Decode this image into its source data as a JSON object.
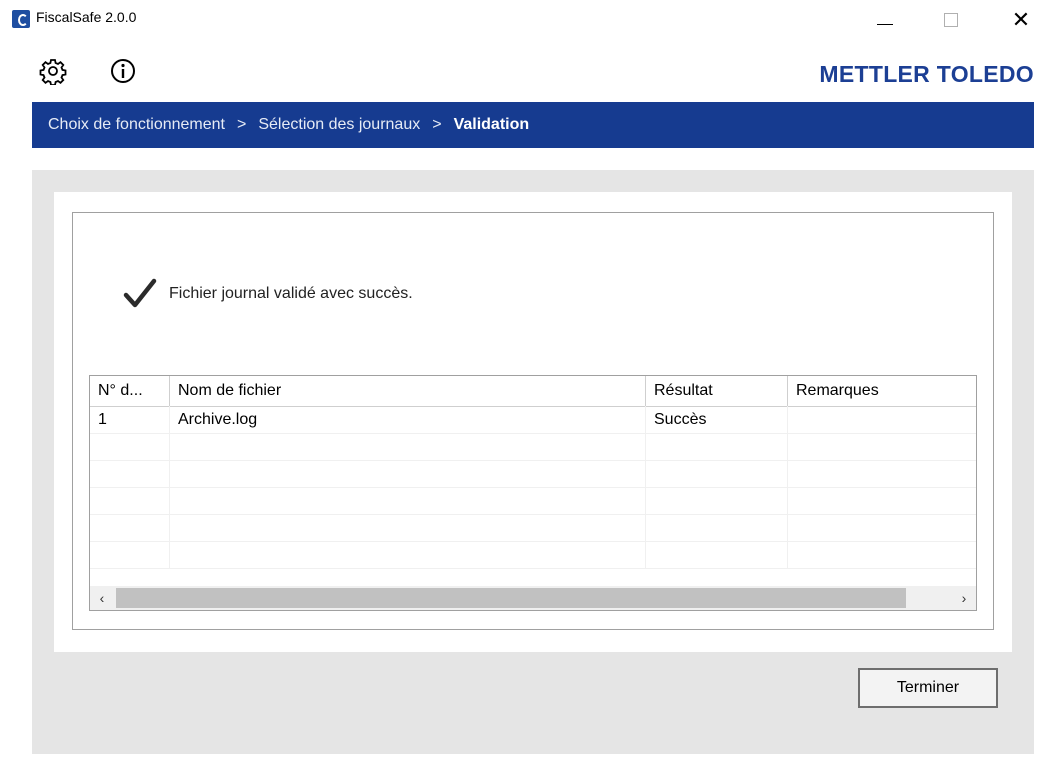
{
  "window": {
    "title": "FiscalSafe 2.0.0",
    "icons": {
      "app": "fiscalsafe-app-icon",
      "minimize": "minimize-icon",
      "maximize": "maximize-icon",
      "close": "close-icon"
    },
    "close_glyph": "✕"
  },
  "toolbar": {
    "settings_icon": "gear-icon",
    "info_icon": "info-icon",
    "brand": "METTLER TOLEDO"
  },
  "breadcrumb": {
    "steps": [
      "Choix de fonctionnement",
      "Sélection des journaux",
      "Validation"
    ],
    "separator": ">",
    "active_index": 2
  },
  "status": {
    "icon": "checkmark-icon",
    "message": "Fichier journal validé avec succès."
  },
  "table": {
    "columns": [
      "N° d...",
      "Nom de fichier",
      "Résultat",
      "Remarques"
    ],
    "rows": [
      [
        "1",
        "Archive.log",
        "Succès",
        ""
      ]
    ],
    "scroll": {
      "left_glyph": "‹",
      "right_glyph": "›"
    }
  },
  "actions": {
    "finish_label": "Terminer"
  },
  "colors": {
    "brand": "#1c3f94",
    "breadcrumb_bg": "#163b90",
    "panel_bg": "#e5e5e5"
  }
}
